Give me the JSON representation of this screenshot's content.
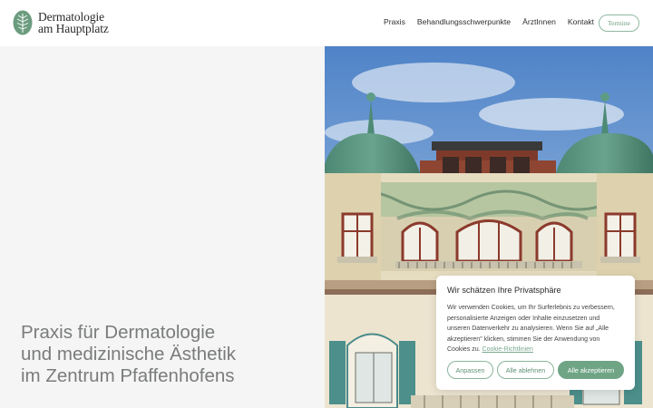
{
  "header": {
    "logo_line1": "Dermatologie",
    "logo_line2": "am Hauptplatz",
    "nav": [
      "Praxis",
      "Behandlungsschwerpunkte",
      "ÄrztInnen",
      "Kontakt"
    ],
    "cta_label": "Termine"
  },
  "hero": {
    "line1": "Praxis für Dermatologie",
    "line2": "und medizinische Ästhetik",
    "line3": "im Zentrum Pfaffenhofens"
  },
  "cookie": {
    "title": "Wir schätzen Ihre Privatsphäre",
    "text": "Wir verwenden Cookies, um Ihr Surferlebnis zu verbessern, personalisierte Anzeigen oder Inhalte einzusetzen und unseren Datenverkehr zu analysieren. Wenn Sie auf „Alle akzeptieren\" klicken, stimmen Sie der Anwendung von Cookies zu.",
    "link": "Cookie-Richtlinien",
    "btn_customize": "Anpassen",
    "btn_reject": "Alle ablehnen",
    "btn_accept": "Alle akzeptieren"
  },
  "colors": {
    "brand_green": "#6fa585",
    "panel_bg": "#f4f5f4",
    "hero_text": "#7a7c7b"
  }
}
